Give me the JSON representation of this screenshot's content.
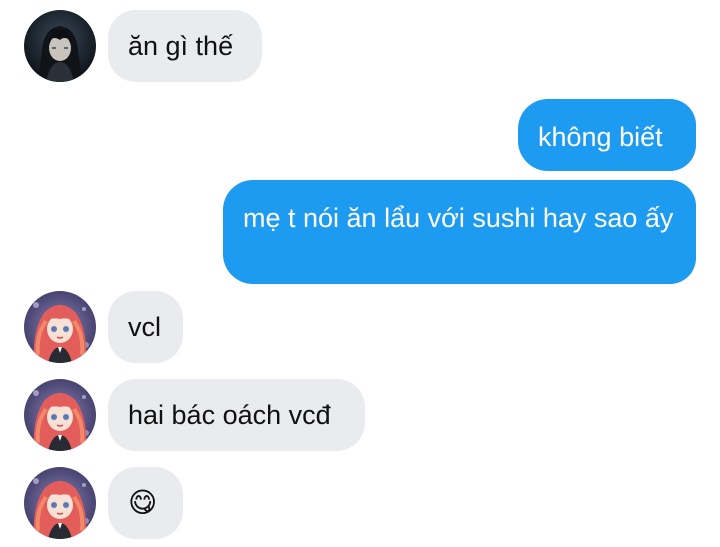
{
  "messages": [
    {
      "id": "m1",
      "direction": "incoming",
      "avatar": "male-character-avatar",
      "text": "ăn gì thế"
    },
    {
      "id": "m2",
      "direction": "outgoing",
      "text": "không biết"
    },
    {
      "id": "m3",
      "direction": "outgoing",
      "text": "mẹ t nói ăn lẩu với sushi hay sao ấy"
    },
    {
      "id": "m4",
      "direction": "incoming",
      "avatar": "pink-hair-character-avatar",
      "text": "vcl"
    },
    {
      "id": "m5",
      "direction": "incoming",
      "avatar": "pink-hair-character-avatar",
      "text": "hai bác oách vcđ"
    },
    {
      "id": "m6",
      "direction": "incoming",
      "avatar": "pink-hair-character-avatar",
      "text": "😋"
    }
  ],
  "colors": {
    "outgoing_bubble": "#1d9bf0",
    "incoming_bubble": "#e9ebef",
    "outgoing_text": "#ffffff",
    "incoming_text": "#111111"
  }
}
